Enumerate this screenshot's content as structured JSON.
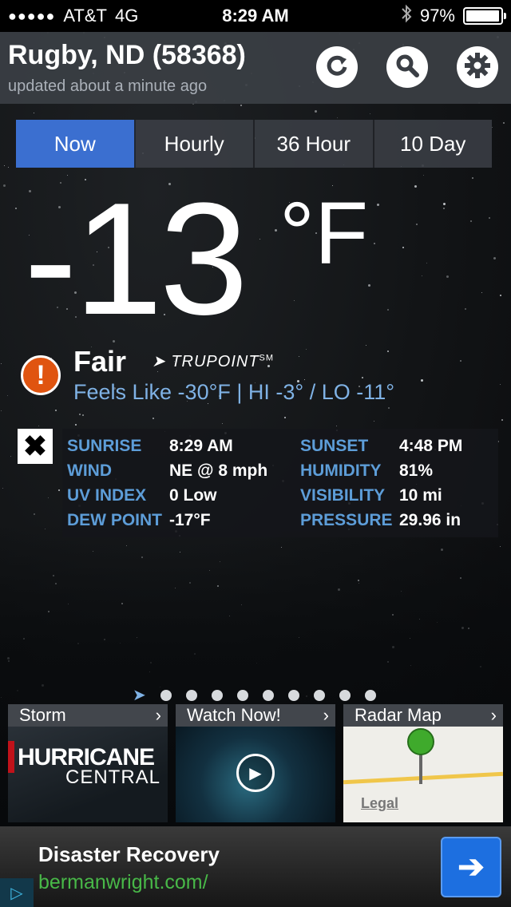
{
  "status_bar": {
    "carrier": "AT&T",
    "network": "4G",
    "time": "8:29 AM",
    "battery": "97%",
    "battery_level": 0.97,
    "icons": [
      "signal-dots-icon",
      "bluetooth-icon",
      "battery-icon"
    ]
  },
  "header": {
    "city": "Rugby, ND (58368)",
    "updated": "updated about a minute ago",
    "icons": [
      "refresh-icon",
      "search-icon",
      "gear-icon"
    ]
  },
  "tabs": [
    {
      "label": "Now",
      "active": true
    },
    {
      "label": "Hourly",
      "active": false
    },
    {
      "label": "36 Hour",
      "active": false
    },
    {
      "label": "10 Day",
      "active": false
    }
  ],
  "current": {
    "temperature": "-13",
    "unit": "°F",
    "condition": "Fair",
    "brand": "TRUPOINT",
    "brand_mark": "SM",
    "feels_like": "Feels Like -30°F | HI -3° / LO -11°"
  },
  "details": [
    {
      "label1": "SUNRISE",
      "value1": "8:29 AM",
      "label2": "SUNSET",
      "value2": "4:48 PM"
    },
    {
      "label1": "WIND",
      "value1": "NE @ 8 mph",
      "label2": "HUMIDITY",
      "value2": "81%"
    },
    {
      "label1": "UV INDEX",
      "value1": "0 Low",
      "label2": "VISIBILITY",
      "value2": "10 mi"
    },
    {
      "label1": "DEW POINT",
      "value1": "-17°F",
      "label2": "PRESSURE",
      "value2": "29.96 in"
    }
  ],
  "pager": {
    "page_count": 9,
    "current_page": 0
  },
  "cards": [
    {
      "label": "Storm",
      "line1": "HURRICANE",
      "line2": "CENTRAL"
    },
    {
      "label": "Watch Now!"
    },
    {
      "label": "Radar Map",
      "legal": "Legal"
    }
  ],
  "ad": {
    "title": "Disaster Recovery",
    "url": "bermanwright.com/"
  },
  "colors": {
    "accent_tab": "#3b6fd0",
    "label_blue": "#5d9dd8",
    "feels_blue": "#7fb2e5",
    "alert_orange": "#e05410",
    "ad_url_green": "#48b848",
    "ad_button_blue": "#1d6fe0"
  }
}
